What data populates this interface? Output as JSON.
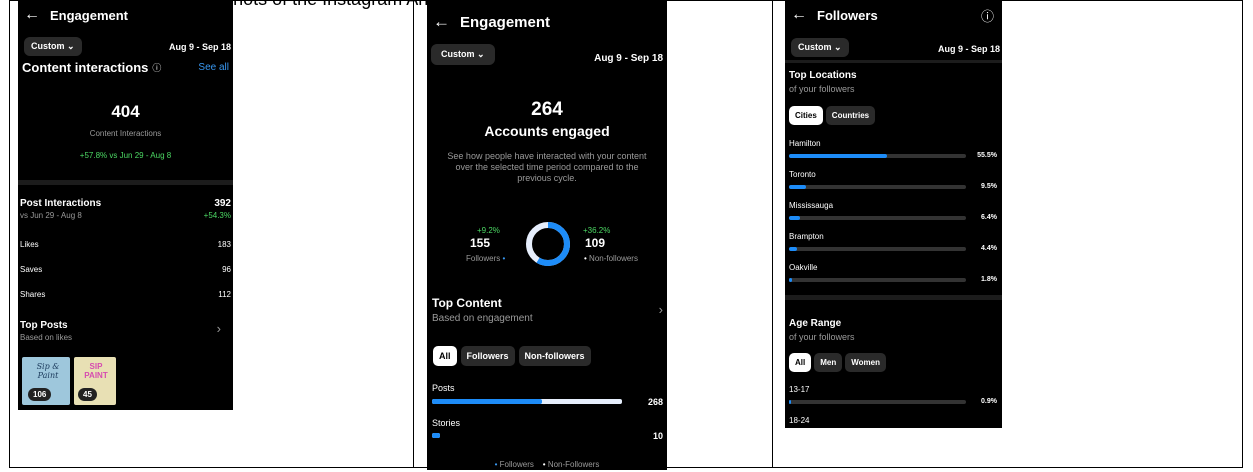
{
  "header_text": "The figures below Screenshots of the Instagram Analytics for the Poster Design",
  "panel1": {
    "title": "Engagement",
    "range_pill": "Custom ⌄",
    "date_range": "Aug 9 - Sep 18",
    "section_title": "Content interactions",
    "info_icon": "ⓘ",
    "see_all": "See all",
    "big_number": "404",
    "big_label": "Content Interactions",
    "change": "+57.8% vs Jun 29 - Aug 8",
    "post_interactions_label": "Post Interactions",
    "post_interactions_value": "392",
    "post_interactions_sub": "vs Jun 29 - Aug 8",
    "post_interactions_change": "+54.3%",
    "metrics": [
      {
        "label": "Likes",
        "value": "183"
      },
      {
        "label": "Saves",
        "value": "96"
      },
      {
        "label": "Shares",
        "value": "112"
      }
    ],
    "top_posts_title": "Top Posts",
    "top_posts_sub": "Based on likes",
    "chevron": "›",
    "thumbs": [
      {
        "count": "106",
        "art": "Sip & Paint"
      },
      {
        "count": "45",
        "art": "SIP PAINT"
      }
    ]
  },
  "panel2": {
    "title": "Engagement",
    "range_pill": "Custom ⌄",
    "date_range": "Aug 9 - Sep 18",
    "big_number": "264",
    "big_label": "Accounts engaged",
    "description": "See how people have interacted with your content over the selected time period compared to the previous cycle.",
    "followers_change": "+9.2%",
    "followers_value": "155",
    "followers_label": "Followers",
    "nonfollowers_change": "+36.2%",
    "nonfollowers_value": "109",
    "nonfollowers_label": "Non-followers",
    "donut_followers_fraction": 0.587,
    "top_content_title": "Top Content",
    "top_content_sub": "Based on engagement",
    "chevron": "›",
    "chips": [
      "All",
      "Followers",
      "Non-followers"
    ],
    "bars": [
      {
        "label": "Posts",
        "value": "268",
        "followers_fraction": 0.58,
        "total_fraction": 1.0
      },
      {
        "label": "Stories",
        "value": "10",
        "followers_fraction": 0.04,
        "total_fraction": 0.04
      }
    ],
    "legend_followers": "Followers",
    "legend_nonfollowers": "Non-Followers"
  },
  "panel3": {
    "title": "Followers",
    "info_icon": "ⓘ",
    "range_pill": "Custom ⌄",
    "date_range": "Aug 9 - Sep 18",
    "locations_title": "Top Locations",
    "locations_sub": "of your followers",
    "location_chips": [
      "Cities",
      "Countries"
    ],
    "cities": [
      {
        "name": "Hamilton",
        "pct": "55.5%",
        "fraction": 0.555
      },
      {
        "name": "Toronto",
        "pct": "9.5%",
        "fraction": 0.095
      },
      {
        "name": "Mississauga",
        "pct": "6.4%",
        "fraction": 0.064
      },
      {
        "name": "Brampton",
        "pct": "4.4%",
        "fraction": 0.044
      },
      {
        "name": "Oakville",
        "pct": "1.8%",
        "fraction": 0.018
      }
    ],
    "age_title": "Age Range",
    "age_sub": "of your followers",
    "age_chips": [
      "All",
      "Men",
      "Women"
    ],
    "ages": [
      {
        "name": "13-17",
        "pct": "0.9%",
        "fraction": 0.009
      },
      {
        "name": "18-24",
        "pct": "",
        "fraction": 0
      }
    ]
  },
  "colors": {
    "accent_blue": "#1d8cf8",
    "positive_green": "#4cd964",
    "panel_bg": "#000000",
    "light_bar": "#e6eefc"
  }
}
